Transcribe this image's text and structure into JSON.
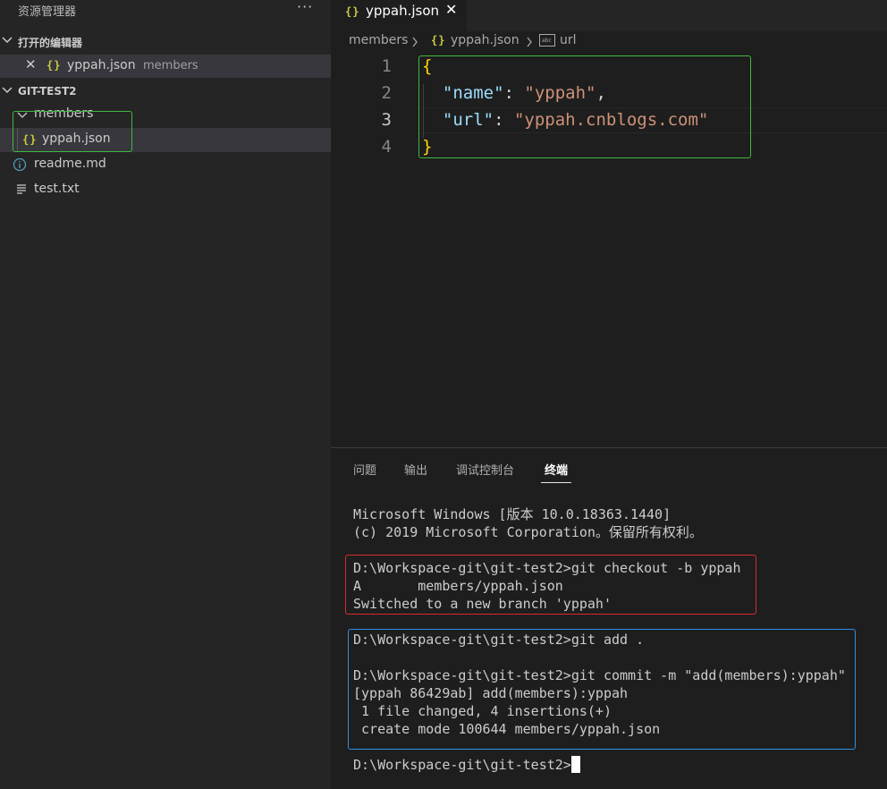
{
  "sidebar": {
    "title": "资源管理器",
    "more": "···",
    "open_editors": {
      "header": "打开的编辑器",
      "items": [
        {
          "icon": "{}",
          "name": "yppah.json",
          "description": "members"
        }
      ]
    },
    "workspace": {
      "header": "GIT-TEST2",
      "tree": [
        {
          "name": "members",
          "type": "folder"
        },
        {
          "icon": "{}",
          "name": "yppah.json",
          "type": "json"
        },
        {
          "name": "readme.md",
          "type": "info"
        },
        {
          "name": "test.txt",
          "type": "text"
        }
      ]
    }
  },
  "tabs": [
    {
      "icon": "{}",
      "label": "yppah.json",
      "close": "✕"
    }
  ],
  "breadcrumb": {
    "folder": "members",
    "file_icon": "{}",
    "file": "yppah.json",
    "symbol": "url"
  },
  "editor": {
    "line_numbers": [
      "1",
      "2",
      "3",
      "4"
    ],
    "lines": {
      "l1_brace": "{",
      "l2_key": "\"name\"",
      "l2_colon": ": ",
      "l2_value": "\"yppah\"",
      "l2_comma": ",",
      "l3_key": "\"url\"",
      "l3_colon": ": ",
      "l3_value": "\"yppah.cnblogs.com\"",
      "l4_brace": "}"
    }
  },
  "panel": {
    "tabs": [
      "问题",
      "输出",
      "调试控制台",
      "终端"
    ],
    "active_tab": "终端",
    "terminal": [
      "Microsoft Windows [版本 10.0.18363.1440]",
      "(c) 2019 Microsoft Corporation。保留所有权利。",
      "D:\\Workspace-git\\git-test2>git checkout -b yppah",
      "A       members/yppah.json",
      "Switched to a new branch 'yppah'",
      "D:\\Workspace-git\\git-test2>git add .",
      "D:\\Workspace-git\\git-test2>git commit -m \"add(members):yppah\"",
      "[yppah 86429ab] add(members):yppah",
      " 1 file changed, 4 insertions(+)",
      " create mode 100644 members/yppah.json",
      "D:\\Workspace-git\\git-test2>"
    ]
  },
  "colors": {
    "accent_green": "#3fb93f",
    "accent_red": "#d92b2b",
    "accent_blue": "#2d8ee8",
    "json_key": "#9cdcfe",
    "json_string": "#ce9178",
    "brace": "#ffd700"
  }
}
